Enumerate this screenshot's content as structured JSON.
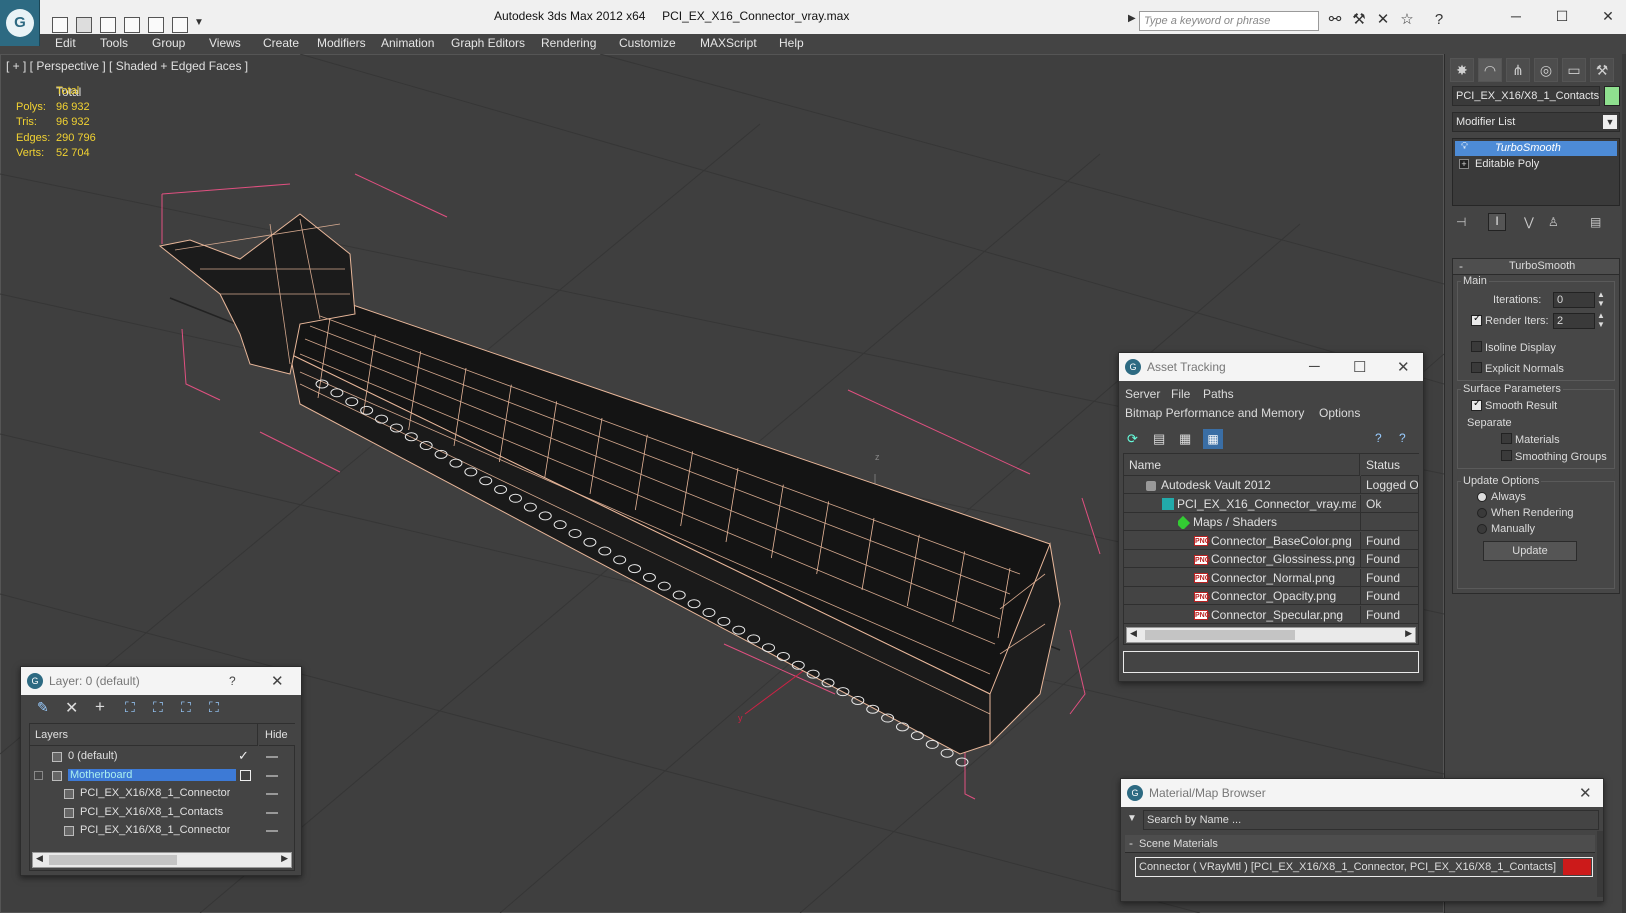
{
  "window": {
    "app_title": "Autodesk 3ds Max  2012 x64",
    "file_title": "PCI_EX_X16_Connector_vray.max"
  },
  "search": {
    "placeholder": "Type a keyword or phrase"
  },
  "menu": [
    "Edit",
    "Tools",
    "Group",
    "Views",
    "Create",
    "Modifiers",
    "Animation",
    "Graph Editors",
    "Rendering",
    "Customize",
    "MAXScript",
    "Help"
  ],
  "viewport": {
    "label": "[ + ] [ Perspective ] [ Shaded + Edged Faces ]",
    "stats": {
      "header": "Total",
      "rows": [
        {
          "label": "Polys:",
          "value": "96 932"
        },
        {
          "label": "Tris:",
          "value": "96 932"
        },
        {
          "label": "Edges:",
          "value": "290 796"
        },
        {
          "label": "Verts:",
          "value": "52 704"
        }
      ]
    },
    "axis_z": "z",
    "axis_y": "y",
    "colors": {
      "wire": "#e8b79a",
      "gizmo": "#e05080",
      "background": "#3f3f3f"
    }
  },
  "command_panel": {
    "object_name": "PCI_EX_X16/X8_1_Contacts",
    "modifier_list": "Modifier List",
    "stack": [
      "TurboSmooth",
      "Editable Poly"
    ],
    "turbosmooth": {
      "title": "TurboSmooth",
      "main": "Main",
      "iterations_label": "Iterations:",
      "iterations": "0",
      "render_iters_label": "Render Iters:",
      "render_iters": "2",
      "isoline": "Isoline Display",
      "explicit": "Explicit Normals",
      "surface": "Surface Parameters",
      "smooth_result": "Smooth Result",
      "separate": "Separate",
      "materials": "Materials",
      "smoothing_groups": "Smoothing Groups",
      "update_options": "Update Options",
      "always": "Always",
      "when_rendering": "When Rendering",
      "manually": "Manually",
      "update": "Update"
    }
  },
  "asset_tracking": {
    "title": "Asset Tracking",
    "menu": [
      "Server",
      "File",
      "Paths"
    ],
    "menu2": [
      "Bitmap Performance and Memory",
      "Options"
    ],
    "headers": {
      "name": "Name",
      "status": "Status"
    },
    "rows": [
      {
        "name": "Autodesk Vault 2012",
        "status": "Logged O",
        "icon": "vault-icon"
      },
      {
        "name": "PCI_EX_X16_Connector_vray.max",
        "status": "Ok",
        "icon": "max-file-icon"
      },
      {
        "name": "Maps / Shaders",
        "status": "",
        "icon": "maps-icon"
      },
      {
        "name": "Connector_BaseColor.png",
        "status": "Found",
        "icon": "png-icon"
      },
      {
        "name": "Connector_Glossiness.png",
        "status": "Found",
        "icon": "png-icon"
      },
      {
        "name": "Connector_Normal.png",
        "status": "Found",
        "icon": "png-icon"
      },
      {
        "name": "Connector_Opacity.png",
        "status": "Found",
        "icon": "png-icon"
      },
      {
        "name": "Connector_Specular.png",
        "status": "Found",
        "icon": "png-icon"
      }
    ],
    "png_badge": "PNG"
  },
  "layers": {
    "title": "Layer: 0 (default)",
    "help": "?",
    "headers": {
      "layers": "Layers",
      "hide": "Hide"
    },
    "rows": [
      {
        "name": "0 (default)"
      },
      {
        "name": "Motherboard"
      },
      {
        "name": "PCI_EX_X16/X8_1_Connector"
      },
      {
        "name": "PCI_EX_X16/X8_1_Contacts"
      },
      {
        "name": "PCI_EX_X16/X8_1_Connector"
      }
    ]
  },
  "material_browser": {
    "title": "Material/Map Browser",
    "search_placeholder": "Search by Name ...",
    "section": "Scene Materials",
    "entry": "Connector  ( VRayMtl )  [PCI_EX_X16/X8_1_Connector, PCI_EX_X16/X8_1_Contacts]",
    "swatch": "#cc1a1a"
  }
}
